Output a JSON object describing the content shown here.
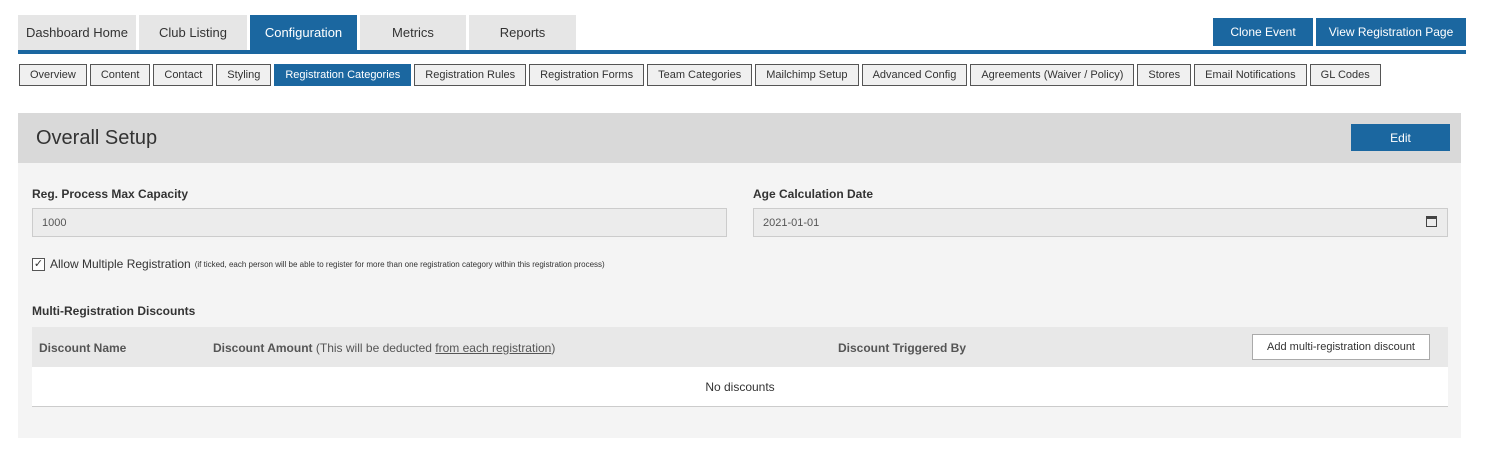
{
  "top_tabs": [
    {
      "label": "Dashboard Home"
    },
    {
      "label": "Club Listing"
    },
    {
      "label": "Configuration",
      "active": true
    },
    {
      "label": "Metrics"
    },
    {
      "label": "Reports"
    }
  ],
  "top_buttons": {
    "clone": "Clone Event",
    "view": "View Registration Page"
  },
  "sub_tabs": [
    {
      "label": "Overview"
    },
    {
      "label": "Content"
    },
    {
      "label": "Contact"
    },
    {
      "label": "Styling"
    },
    {
      "label": "Registration Categories",
      "active": true
    },
    {
      "label": "Registration Rules"
    },
    {
      "label": "Registration Forms"
    },
    {
      "label": "Team Categories"
    },
    {
      "label": "Mailchimp Setup"
    },
    {
      "label": "Advanced Config"
    },
    {
      "label": "Agreements (Waiver / Policy)"
    },
    {
      "label": "Stores"
    },
    {
      "label": "Email Notifications"
    },
    {
      "label": "GL Codes"
    }
  ],
  "panel": {
    "title": "Overall Setup",
    "edit": "Edit",
    "max_capacity_label": "Reg. Process Max Capacity",
    "max_capacity_value": "1000",
    "age_date_label": "Age Calculation Date",
    "age_date_value": "2021-01-01",
    "allow_multiple_label": "Allow Multiple Registration",
    "allow_multiple_checked": true,
    "allow_multiple_hint": "(if ticked, each person will be able to register for more than one registration category within this registration process)",
    "discounts_title": "Multi-Registration Discounts",
    "col_name": "Discount Name",
    "col_amount": "Discount Amount",
    "col_amount_note_pre": "(This will be deducted ",
    "col_amount_note_link": "from each registration",
    "col_amount_note_post": ")",
    "col_trigger": "Discount Triggered By",
    "add_button": "Add multi-registration discount",
    "empty": "No discounts"
  },
  "colors": {
    "accent": "#1b67a0"
  }
}
